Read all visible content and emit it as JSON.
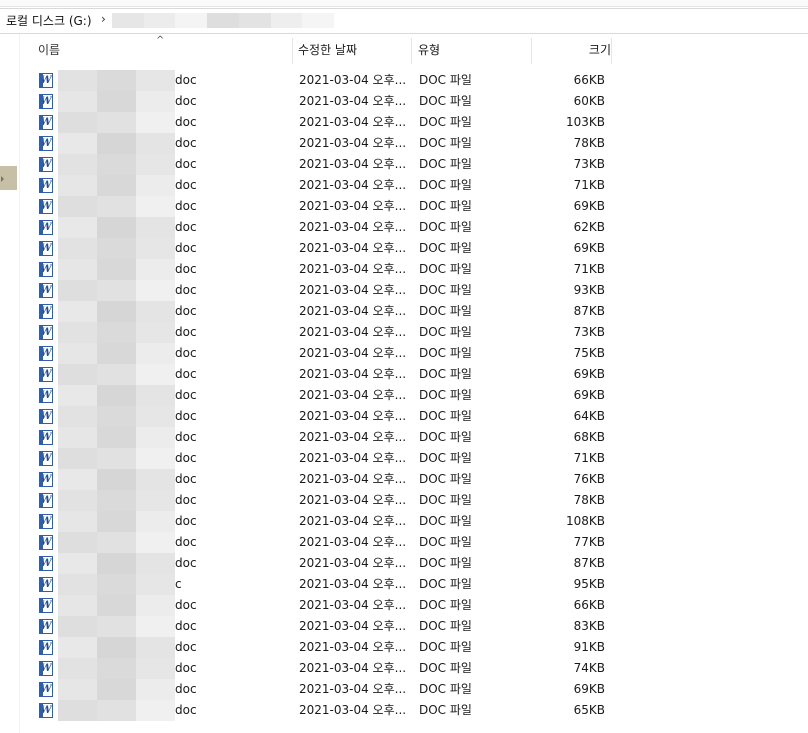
{
  "address": {
    "location": "로컬 디스크 (G:)",
    "separator": "›"
  },
  "columns": {
    "name": "이름",
    "date": "수정한 날짜",
    "type": "유형",
    "size": "크기",
    "sort_indicator": "^"
  },
  "files": [
    {
      "ext": "doc",
      "date": "2021-03-04 오후...",
      "type": "DOC 파일",
      "size": "66KB"
    },
    {
      "ext": "doc",
      "date": "2021-03-04 오후...",
      "type": "DOC 파일",
      "size": "60KB"
    },
    {
      "ext": "doc",
      "date": "2021-03-04 오후...",
      "type": "DOC 파일",
      "size": "103KB"
    },
    {
      "ext": "doc",
      "date": "2021-03-04 오후...",
      "type": "DOC 파일",
      "size": "78KB"
    },
    {
      "ext": "doc",
      "date": "2021-03-04 오후...",
      "type": "DOC 파일",
      "size": "73KB"
    },
    {
      "ext": "doc",
      "date": "2021-03-04 오후...",
      "type": "DOC 파일",
      "size": "71KB"
    },
    {
      "ext": "doc",
      "date": "2021-03-04 오후...",
      "type": "DOC 파일",
      "size": "69KB"
    },
    {
      "ext": "doc",
      "date": "2021-03-04 오후...",
      "type": "DOC 파일",
      "size": "62KB"
    },
    {
      "ext": "doc",
      "date": "2021-03-04 오후...",
      "type": "DOC 파일",
      "size": "69KB"
    },
    {
      "ext": "doc",
      "date": "2021-03-04 오후...",
      "type": "DOC 파일",
      "size": "71KB"
    },
    {
      "ext": "doc",
      "date": "2021-03-04 오후...",
      "type": "DOC 파일",
      "size": "93KB"
    },
    {
      "ext": "doc",
      "date": "2021-03-04 오후...",
      "type": "DOC 파일",
      "size": "87KB"
    },
    {
      "ext": "doc",
      "date": "2021-03-04 오후...",
      "type": "DOC 파일",
      "size": "73KB"
    },
    {
      "ext": "doc",
      "date": "2021-03-04 오후...",
      "type": "DOC 파일",
      "size": "75KB"
    },
    {
      "ext": "doc",
      "date": "2021-03-04 오후...",
      "type": "DOC 파일",
      "size": "69KB"
    },
    {
      "ext": "doc",
      "date": "2021-03-04 오후...",
      "type": "DOC 파일",
      "size": "69KB"
    },
    {
      "ext": "doc",
      "date": "2021-03-04 오후...",
      "type": "DOC 파일",
      "size": "64KB"
    },
    {
      "ext": "doc",
      "date": "2021-03-04 오후...",
      "type": "DOC 파일",
      "size": "68KB"
    },
    {
      "ext": "doc",
      "date": "2021-03-04 오후...",
      "type": "DOC 파일",
      "size": "71KB"
    },
    {
      "ext": "doc",
      "date": "2021-03-04 오후...",
      "type": "DOC 파일",
      "size": "76KB"
    },
    {
      "ext": "doc",
      "date": "2021-03-04 오후...",
      "type": "DOC 파일",
      "size": "78KB"
    },
    {
      "ext": "doc",
      "date": "2021-03-04 오후...",
      "type": "DOC 파일",
      "size": "108KB"
    },
    {
      "ext": "doc",
      "date": "2021-03-04 오후...",
      "type": "DOC 파일",
      "size": "77KB"
    },
    {
      "ext": "doc",
      "date": "2021-03-04 오후...",
      "type": "DOC 파일",
      "size": "87KB"
    },
    {
      "ext": "c",
      "date": "2021-03-04 오후...",
      "type": "DOC 파일",
      "size": "95KB"
    },
    {
      "ext": "doc",
      "date": "2021-03-04 오후...",
      "type": "DOC 파일",
      "size": "66KB"
    },
    {
      "ext": "doc",
      "date": "2021-03-04 오후...",
      "type": "DOC 파일",
      "size": "83KB"
    },
    {
      "ext": "doc",
      "date": "2021-03-04 오후...",
      "type": "DOC 파일",
      "size": "91KB"
    },
    {
      "ext": "doc",
      "date": "2021-03-04 오후...",
      "type": "DOC 파일",
      "size": "74KB"
    },
    {
      "ext": "doc",
      "date": "2021-03-04 오후...",
      "type": "DOC 파일",
      "size": "69KB"
    },
    {
      "ext": "doc",
      "date": "2021-03-04 오후...",
      "type": "DOC 파일",
      "size": "65KB"
    }
  ],
  "icons": {
    "file": "word-doc-icon"
  }
}
